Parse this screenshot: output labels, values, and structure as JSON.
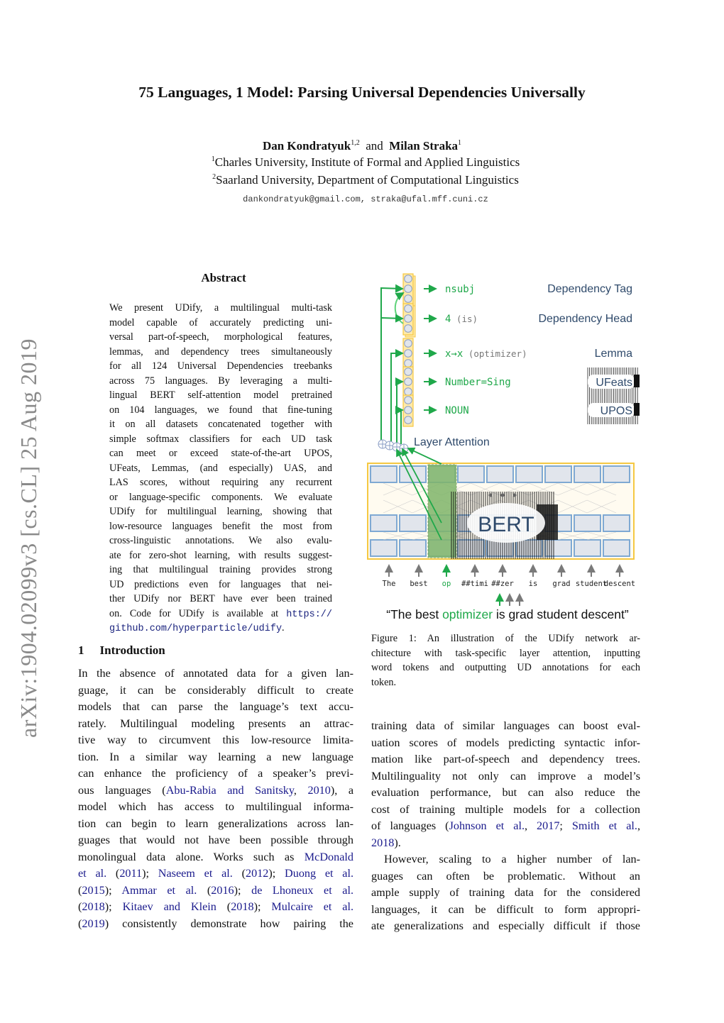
{
  "paper": {
    "title": "75 Languages, 1 Model: Parsing Universal Dependencies Universally",
    "authors": [
      {
        "name": "Dan Kondratyuk",
        "affil": "1,2"
      },
      {
        "name": "Milan Straka",
        "affil": "1"
      }
    ],
    "author_joiner": "and",
    "affiliations": [
      {
        "mark": "1",
        "text": "Charles University, Institute of Formal and Applied Linguistics"
      },
      {
        "mark": "2",
        "text": "Saarland University, Department of Computational Linguistics"
      }
    ],
    "emails": "dankondratyuk@gmail.com, straka@ufal.mff.cuni.cz",
    "arxiv_stamp": "arXiv:1904.02099v3  [cs.CL]  25 Aug 2019"
  },
  "abstract": {
    "heading": "Abstract",
    "lines": [
      "We present UDify, a multilingual multi-task",
      "model capable of accurately predicting uni-",
      "versal part-of-speech, morphological features,",
      "lemmas, and dependency trees simultaneously",
      "for all 124 Universal Dependencies treebanks",
      "across 75 languages.  By leveraging a multi-",
      "lingual BERT self-attention model pretrained",
      "on 104 languages, we found that fine-tuning",
      "it on all datasets concatenated together with",
      "simple softmax classifiers for each UD task",
      "can meet or exceed state-of-the-art UPOS,",
      "UFeats, Lemmas, (and especially) UAS, and",
      "LAS scores, without requiring any recurrent",
      "or language-specific components. We evaluate",
      "UDify for multilingual learning, showing that",
      "low-resource languages benefit the most from",
      "cross-linguistic annotations.  We also evalu-",
      "ate for zero-shot learning, with results suggest-",
      "ing that multilingual training provides strong",
      "UD predictions even for languages that nei-",
      "ther UDify nor BERT have ever been trained"
    ],
    "code_prefix": "on. Code for UDify is available at",
    "code_url_part1": "https://",
    "code_url_part2": "github.com/hyperparticle/udify",
    "code_suffix": "."
  },
  "section1": {
    "number": "1",
    "heading": "Introduction",
    "left_lines": [
      [
        {
          "t": "In the absence of annotated data for a given lan-"
        }
      ],
      [
        {
          "t": "guage, it can be considerably difficult to create"
        }
      ],
      [
        {
          "t": "models that can parse the language’s text accu-"
        }
      ],
      [
        {
          "t": "rately.  Multilingual modeling presents an attrac-"
        }
      ],
      [
        {
          "t": "tive way to circumvent this low-resource limita-"
        }
      ],
      [
        {
          "t": "tion.  In a similar way learning a new language"
        }
      ],
      [
        {
          "t": "can enhance the proficiency of a speaker’s previ-"
        }
      ],
      [
        {
          "t": "ous languages ("
        },
        {
          "t": "Abu-Rabia and Sanitsky",
          "link": true
        },
        {
          "t": ", "
        },
        {
          "t": "2010",
          "link": true
        },
        {
          "t": "), a"
        }
      ],
      [
        {
          "t": "model which has access to multilingual informa-"
        }
      ],
      [
        {
          "t": "tion can begin to learn generalizations across lan-"
        }
      ],
      [
        {
          "t": "guages that would not have been possible through"
        }
      ],
      [
        {
          "t": "monolingual data alone. Works such as "
        },
        {
          "t": "McDonald",
          "link": true
        }
      ],
      [
        {
          "t": "et al.",
          "link": true
        },
        {
          "t": " ("
        },
        {
          "t": "2011",
          "link": true
        },
        {
          "t": "); "
        },
        {
          "t": "Naseem et al.",
          "link": true
        },
        {
          "t": " ("
        },
        {
          "t": "2012",
          "link": true
        },
        {
          "t": "); "
        },
        {
          "t": "Duong et al.",
          "link": true
        }
      ],
      [
        {
          "t": "("
        },
        {
          "t": "2015",
          "link": true
        },
        {
          "t": "); "
        },
        {
          "t": "Ammar et al.",
          "link": true
        },
        {
          "t": " ("
        },
        {
          "t": "2016",
          "link": true
        },
        {
          "t": "); "
        },
        {
          "t": "de Lhoneux et al.",
          "link": true
        }
      ],
      [
        {
          "t": "("
        },
        {
          "t": "2018",
          "link": true
        },
        {
          "t": "); "
        },
        {
          "t": "Kitaev and Klein",
          "link": true
        },
        {
          "t": " ("
        },
        {
          "t": "2018",
          "link": true
        },
        {
          "t": "); "
        },
        {
          "t": "Mulcaire et al.",
          "link": true
        }
      ],
      [
        {
          "t": "("
        },
        {
          "t": "2019",
          "link": true
        },
        {
          "t": ") consistently demonstrate how pairing the"
        }
      ]
    ],
    "right_lines": [
      [
        {
          "t": "training data of similar languages can boost eval-"
        }
      ],
      [
        {
          "t": "uation scores of models predicting syntactic infor-"
        }
      ],
      [
        {
          "t": "mation like part-of-speech and dependency trees."
        }
      ],
      [
        {
          "t": "Multilinguality not only can improve a model’s"
        }
      ],
      [
        {
          "t": "evaluation performance, but can also reduce the"
        }
      ],
      [
        {
          "t": "cost of training multiple models for a collection"
        }
      ],
      [
        {
          "t": "of languages ("
        },
        {
          "t": "Johnson et al.",
          "link": true
        },
        {
          "t": ", "
        },
        {
          "t": "2017",
          "link": true
        },
        {
          "t": "; "
        },
        {
          "t": "Smith et al.",
          "link": true
        },
        {
          "t": ","
        }
      ],
      [
        {
          "t": "2018",
          "link": true
        },
        {
          "t": ")."
        }
      ],
      [
        {
          "t": "However, scaling to a higher number of lan-",
          "indent": true
        }
      ],
      [
        {
          "t": "guages can often be problematic.   Without an"
        }
      ],
      [
        {
          "t": "ample supply of training data for the considered"
        }
      ],
      [
        {
          "t": "languages, it can be difficult to form appropri-"
        }
      ],
      [
        {
          "t": "ate generalizations and especially difficult if those"
        }
      ]
    ]
  },
  "figure1": {
    "outputs": [
      {
        "value": "nsubj",
        "note": "",
        "task": "Dependency Tag"
      },
      {
        "value": "4",
        "note": "(is)",
        "task": "Dependency Head"
      },
      {
        "value": "x→x",
        "note": "(optimizer)",
        "task": "Lemma"
      },
      {
        "value": "Number=Sing",
        "note": "",
        "task": "UFeats"
      },
      {
        "value": "NOUN",
        "note": "",
        "task": "UPOS"
      }
    ],
    "layer_attention_label": "Layer Attention",
    "model_label": "BERT",
    "tokens": [
      "The",
      "best",
      "op",
      "##timi",
      "##zer",
      "is",
      "grad",
      "student",
      "descent"
    ],
    "highlighted_token": "op",
    "sentence_parts": [
      "“The best ",
      "optimizer",
      " is grad student descent”"
    ],
    "colors": {
      "green": "#1fa84a",
      "label_blue": "#2f4a6b",
      "cell_fill": "#e1e5ec",
      "cell_border": "#7fa9d3",
      "frame": "#f5c842",
      "frame_fill": "#fffbf0",
      "highlight": "#7fb56a",
      "arrow_gray": "#7a7a7a"
    },
    "caption_lines": [
      "Figure 1:   An illustration of the UDify network ar-",
      "chitecture with task-specific layer attention, inputting",
      "word tokens and outputting UD annotations for each",
      "token."
    ]
  }
}
